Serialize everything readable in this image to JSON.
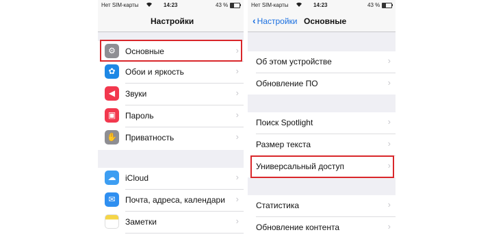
{
  "left": {
    "status": {
      "carrier": "Нет SIM-карты",
      "time": "14:23",
      "battery": "43 %"
    },
    "title": "Настройки",
    "items": [
      {
        "label": "Основные",
        "icon": "gear-icon",
        "color": "#8e8e93",
        "glyph": "⚙"
      },
      {
        "label": "Обои и яркость",
        "icon": "flower-icon",
        "color": "#1e88e5",
        "glyph": "✿"
      },
      {
        "label": "Звуки",
        "icon": "speaker-icon",
        "color": "#f2384e",
        "glyph": "◀"
      },
      {
        "label": "Пароль",
        "icon": "lock-icon",
        "color": "#f2384e",
        "glyph": "▣"
      },
      {
        "label": "Приватность",
        "icon": "hand-icon",
        "color": "#8e8e93",
        "glyph": "✋"
      },
      {
        "label": "iCloud",
        "icon": "cloud-icon",
        "color": "#3d9ef2",
        "glyph": "☁"
      },
      {
        "label": "Почта, адреса, календари",
        "icon": "mail-icon",
        "color": "#2f8ff0",
        "glyph": "✉"
      },
      {
        "label": "Заметки",
        "icon": "notes-icon",
        "color": "#f5d547",
        "glyph": ""
      }
    ]
  },
  "right": {
    "status": {
      "carrier": "Нет SIM-карты",
      "time": "14:23",
      "battery": "43 %"
    },
    "back_label": "Настройки",
    "title": "Основные",
    "items": [
      {
        "label": "Об этом устройстве"
      },
      {
        "label": "Обновление ПО"
      },
      {
        "label": "Поиск Spotlight"
      },
      {
        "label": "Размер текста"
      },
      {
        "label": "Универсальный доступ"
      },
      {
        "label": "Статистика"
      },
      {
        "label": "Обновление контента"
      }
    ]
  },
  "highlight_color": "#d9262a",
  "accent_color": "#1a6fe0"
}
